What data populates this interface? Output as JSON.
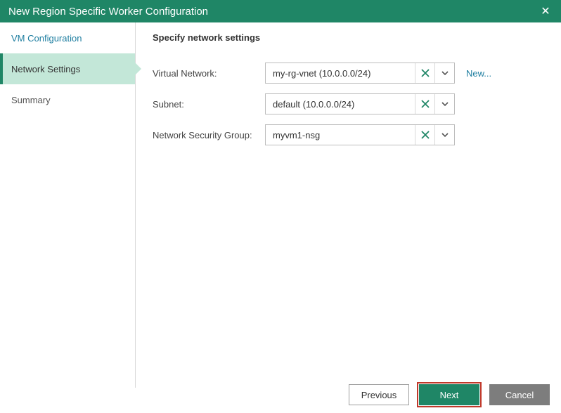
{
  "window": {
    "title": "New Region Specific Worker Configuration"
  },
  "sidebar": {
    "steps": [
      {
        "label": "VM Configuration"
      },
      {
        "label": "Network Settings"
      },
      {
        "label": "Summary"
      }
    ]
  },
  "main": {
    "heading": "Specify network settings",
    "fields": {
      "virtual_network": {
        "label": "Virtual Network:",
        "value": "my-rg-vnet (10.0.0.0/24)",
        "new_link": "New..."
      },
      "subnet": {
        "label": "Subnet:",
        "value": "default (10.0.0.0/24)"
      },
      "nsg": {
        "label": "Network Security Group:",
        "value": "myvm1-nsg"
      }
    }
  },
  "footer": {
    "previous": "Previous",
    "next": "Next",
    "cancel": "Cancel"
  }
}
